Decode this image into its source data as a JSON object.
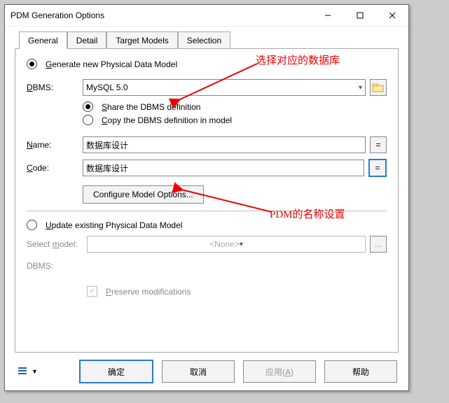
{
  "window": {
    "title": "PDM Generation Options"
  },
  "tabs": [
    "General",
    "Detail",
    "Target Models",
    "Selection"
  ],
  "gen": {
    "generate_label": "Generate new Physical Data Model",
    "dbms_label": "DBMS:",
    "dbms_value": "MySQL 5.0",
    "share_label": "Share the DBMS definition",
    "copy_label": "Copy the DBMS definition in model",
    "name_label": "Name:",
    "name_value": "数据库设计",
    "code_label": "Code:",
    "code_value": "数据库设计",
    "configure_label": "Configure Model Options...",
    "eq": "="
  },
  "upd": {
    "update_label": "Update existing Physical Data Model",
    "select_model_label": "Select model:",
    "select_model_value": "<None>",
    "dbms_label": "DBMS:",
    "dbms_value": "",
    "preserve_label": "Preserve modifications",
    "dots": "..."
  },
  "footer": {
    "ok": "确定",
    "cancel": "取消",
    "apply": "应用(A)",
    "help": "帮助"
  },
  "anno": {
    "a1": "选择对应的数据库",
    "a2": "PDM的名称设置"
  }
}
